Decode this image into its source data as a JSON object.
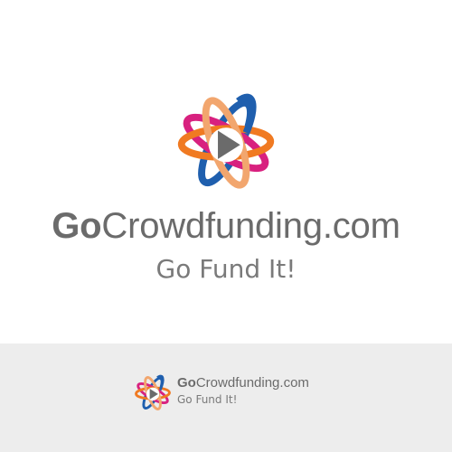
{
  "brand": {
    "name_bold": "Go",
    "name_rest": "Crowdfunding.com",
    "tagline": "Go Fund It!",
    "colors": {
      "blue": "#1f5fae",
      "magenta": "#d8217f",
      "orange": "#f07a22",
      "peach": "#f2a66e",
      "play": "#6b6b6b",
      "text": "#6b6b6b"
    }
  },
  "footer": {
    "name_bold": "Go",
    "name_rest": "Crowdfunding.com",
    "tagline": "Go Fund It!"
  }
}
